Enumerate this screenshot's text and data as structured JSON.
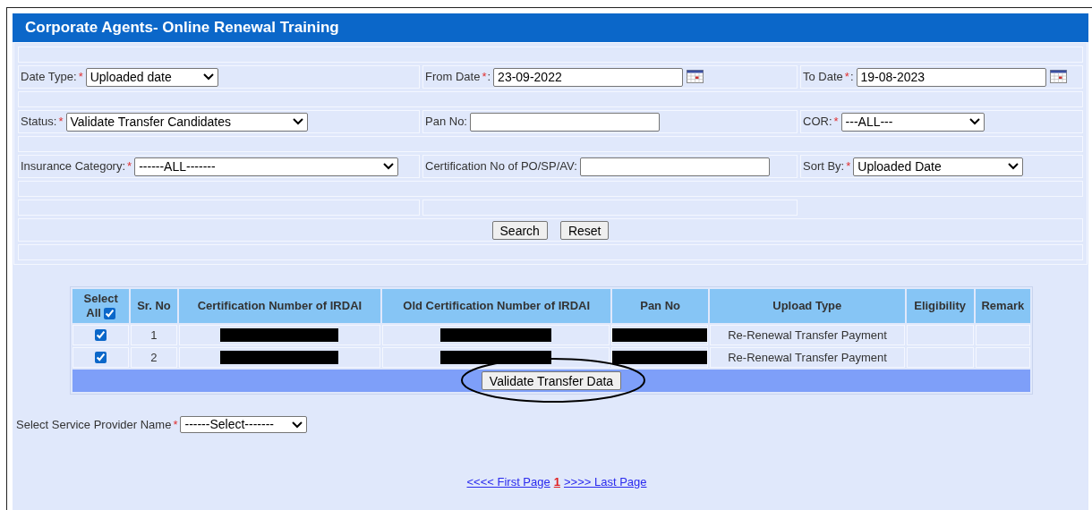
{
  "title": "Corporate Agents- Online Renewal Training",
  "form_rows": [
    [
      {
        "kind": "select",
        "label": "Date Type:",
        "asterisk": "*",
        "value": "Uploaded date"
      },
      {
        "kind": "date",
        "label": "From Date",
        "asterisk": "*",
        "label_end": ":",
        "value": "23-09-2022"
      },
      {
        "kind": "date",
        "label": "To Date",
        "asterisk": "*",
        "label_end": ":",
        "value": "19-08-2023"
      }
    ],
    [
      {
        "kind": "select",
        "label": "Status:",
        "asterisk": "*",
        "value": "Validate Transfer Candidates"
      },
      {
        "kind": "text",
        "label": "Pan No:"
      },
      {
        "kind": "select",
        "label": "COR:",
        "asterisk": "*",
        "value": "---ALL---"
      }
    ],
    [
      {
        "kind": "select",
        "label": "Insurance Category:",
        "asterisk": "*",
        "value": "------ALL-------"
      },
      {
        "kind": "text",
        "label": "Certification No of PO/SP/AV:"
      },
      {
        "kind": "select",
        "label": "Sort By:",
        "asterisk": "*",
        "value": "Uploaded Date"
      }
    ]
  ],
  "buttons": [
    "Search",
    "Reset"
  ],
  "table": {
    "select_all": {
      "label": "Select All",
      "checked": true
    },
    "columns": [
      "Sr. No",
      "Certification Number of IRDAI",
      "Old Certification Number of IRDAI",
      "Pan No",
      "Upload Type",
      "Eligibility",
      "Remark"
    ],
    "rows": [
      {
        "checked": true,
        "sr": "1",
        "cells": [
          {
            "redacted": true
          },
          {
            "redacted": true
          },
          {
            "redacted": true
          },
          {
            "text": "Re-Renewal Transfer Payment"
          },
          {},
          {}
        ]
      },
      {
        "checked": true,
        "sr": "2",
        "cells": [
          {
            "redacted": true
          },
          {
            "redacted": true
          },
          {
            "redacted": true
          },
          {
            "text": "Re-Renewal Transfer Payment"
          },
          {},
          {}
        ]
      }
    ],
    "action": {
      "label": "Validate Transfer Data",
      "circled": true
    }
  },
  "service_provider": {
    "label": "Select Service Provider Name",
    "asterisk": "*",
    "value": "------Select-------"
  },
  "pagination": {
    "first": "<<<< First Page",
    "current": "1",
    "last": ">>>> Last Page"
  }
}
